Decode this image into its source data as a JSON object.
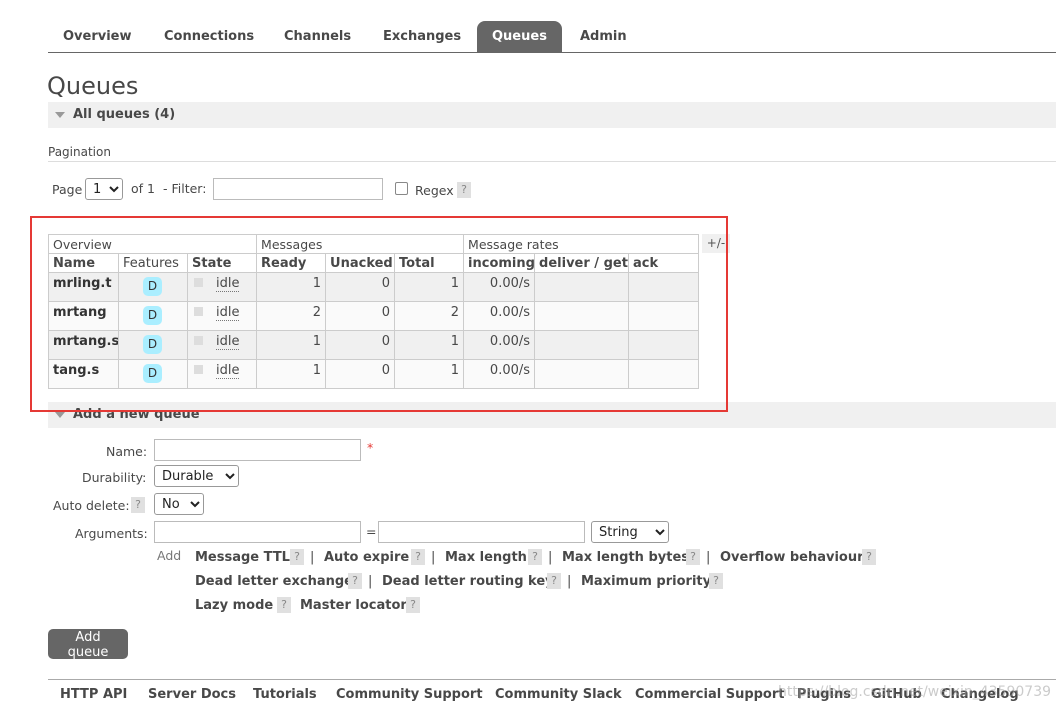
{
  "nav": {
    "tabs": [
      {
        "label": "Overview"
      },
      {
        "label": "Connections"
      },
      {
        "label": "Channels"
      },
      {
        "label": "Exchanges"
      },
      {
        "label": "Queues",
        "active": true
      },
      {
        "label": "Admin"
      }
    ]
  },
  "page_title": "Queues",
  "all_queues": {
    "label": "All queues (4)"
  },
  "pagination": {
    "section_label": "Pagination",
    "page_label": "Page",
    "page_value": "1",
    "of_label": "of 1",
    "filter_label": "- Filter:",
    "filter_value": "",
    "regex_label": "Regex",
    "help": "?"
  },
  "table": {
    "groups": [
      "Overview",
      "Messages",
      "Message rates"
    ],
    "columns": [
      "Name",
      "Features",
      "State",
      "Ready",
      "Unacked",
      "Total",
      "incoming",
      "deliver / get",
      "ack"
    ],
    "plus_minus": "+/-",
    "rows": [
      {
        "name": "mrling.t",
        "feature": "D",
        "state": "idle",
        "ready": "1",
        "unacked": "0",
        "total": "1",
        "incoming": "0.00/s",
        "deliver_get": "",
        "ack": ""
      },
      {
        "name": "mrtang",
        "feature": "D",
        "state": "idle",
        "ready": "2",
        "unacked": "0",
        "total": "2",
        "incoming": "0.00/s",
        "deliver_get": "",
        "ack": ""
      },
      {
        "name": "mrtang.s",
        "feature": "D",
        "state": "idle",
        "ready": "1",
        "unacked": "0",
        "total": "1",
        "incoming": "0.00/s",
        "deliver_get": "",
        "ack": ""
      },
      {
        "name": "tang.s",
        "feature": "D",
        "state": "idle",
        "ready": "1",
        "unacked": "0",
        "total": "1",
        "incoming": "0.00/s",
        "deliver_get": "",
        "ack": ""
      }
    ]
  },
  "add_queue": {
    "section_label": "Add a new queue",
    "name_label": "Name:",
    "name_value": "",
    "required_mark": "*",
    "durability_label": "Durability:",
    "durability_value": "Durable",
    "auto_delete_label": "Auto delete:",
    "auto_delete_value": "No",
    "arguments_label": "Arguments:",
    "equals": "=",
    "arg_type_value": "String",
    "add_label": "Add",
    "separator": "|",
    "arg_links": [
      "Message TTL",
      "Auto expire",
      "Max length",
      "Max length bytes",
      "Overflow behaviour",
      "Dead letter exchange",
      "Dead letter routing key",
      "Maximum priority",
      "Lazy mode",
      "Master locator"
    ],
    "submit_label": "Add queue"
  },
  "footer": {
    "links": [
      "HTTP API",
      "Server Docs",
      "Tutorials",
      "Community Support",
      "Community Slack",
      "Commercial Support",
      "Plugins",
      "GitHub",
      "Changelog"
    ]
  },
  "watermark": "https://blog.csdn.net/weixin_43590739",
  "colors": {
    "highlight": "#e53935",
    "active_tab": "#666666",
    "feature_badge": "#aaeeff"
  }
}
